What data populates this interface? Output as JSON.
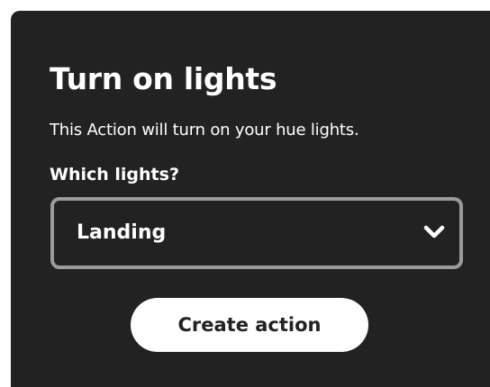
{
  "action": {
    "title": "Turn on lights",
    "description": "This Action will turn on your hue lights.",
    "field_label": "Which lights?",
    "selected_value": "Landing",
    "dropdown_icon": "chevron-down-icon",
    "submit_label": "Create action"
  }
}
